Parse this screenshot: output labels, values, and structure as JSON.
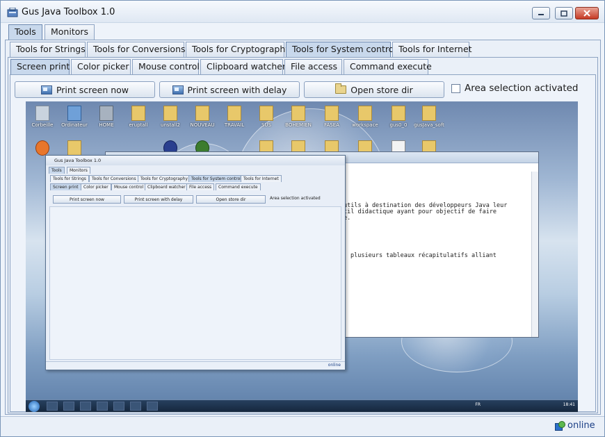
{
  "window": {
    "title": "Gus Java Toolbox 1.0"
  },
  "main_tabs": [
    {
      "label": "Tools"
    },
    {
      "label": "Monitors"
    }
  ],
  "tool_tabs": [
    {
      "label": "Tools for Strings"
    },
    {
      "label": "Tools for Conversions"
    },
    {
      "label": "Tools for Cryptography"
    },
    {
      "label": "Tools for System control"
    },
    {
      "label": "Tools for Internet"
    }
  ],
  "system_tabs": [
    {
      "label": "Screen print"
    },
    {
      "label": "Color picker"
    },
    {
      "label": "Mouse control"
    },
    {
      "label": "Clipboard watcher"
    },
    {
      "label": "File access"
    },
    {
      "label": "Command execute"
    }
  ],
  "toolbar": {
    "print_now": "Print screen now",
    "print_delay": "Print screen with delay",
    "open_store": "Open store dir",
    "area_selection": "Area selection activated"
  },
  "preview": {
    "desktop_icons": [
      "Corbeille",
      "Ordinateur",
      "HOME",
      "eruptall",
      "unstall2",
      "NOUVEAU",
      "TRAVAIL",
      "SUS",
      "BOHEMIEN",
      "FASEA",
      "workspace",
      "gus0_0",
      "gusJava_soft"
    ],
    "editor_lines": [
      "utils à destination des développeurs Java leur",
      "til didactique ayant pour objectif de faire",
      "e.",
      "plusieurs tableaux récapitulatifs alliant"
    ],
    "tray_text": "FR",
    "clock": "18:41",
    "nested": {
      "title": "Gus Java Toolbox 1.0",
      "main_tabs": [
        "Tools",
        "Monitors"
      ],
      "tool_tabs": [
        "Tools for Strings",
        "Tools for Conversions",
        "Tools for Cryptography",
        "Tools for System control",
        "Tools for Internet"
      ],
      "system_tabs": [
        "Screen print",
        "Color picker",
        "Mouse control",
        "Clipboard watcher",
        "File access",
        "Command execute"
      ],
      "buttons": [
        "Print screen now",
        "Print screen with delay",
        "Open store dir"
      ],
      "checkbox": "Area selection activated",
      "status": "online"
    }
  },
  "status": {
    "label": "online"
  },
  "colors": {
    "accent": "#c8d8ec",
    "border": "#8da3c2",
    "status_text": "#1b3f86"
  }
}
